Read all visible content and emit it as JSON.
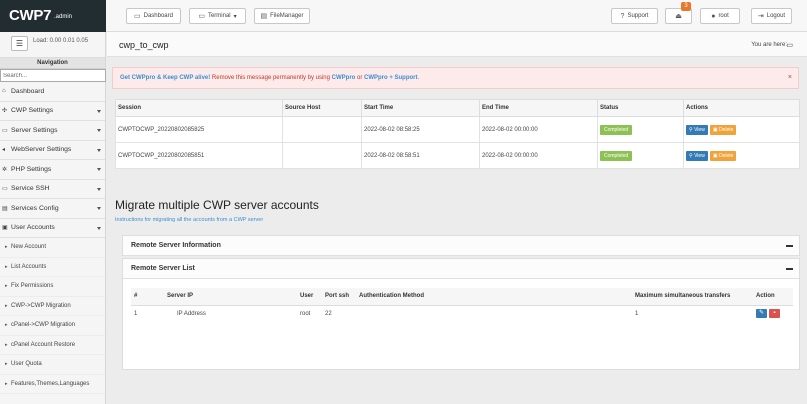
{
  "brand": {
    "name": "CWP7",
    "suffix": ".admin"
  },
  "topnav": {
    "dashboard": "Dashboard",
    "terminal": "Terminal",
    "filemanager": "FileManager",
    "support": "Support",
    "notifications_count": "3",
    "user": "root",
    "logout": "Logout"
  },
  "sidebar": {
    "load": "Load: 0.00 0.01 0.05",
    "nav_title": "Navigation",
    "search_placeholder": "Search...",
    "items": [
      {
        "label": "Dashboard",
        "icon": "home-icon"
      },
      {
        "label": "CWP Settings",
        "icon": "wrench-icon"
      },
      {
        "label": "Server Settings",
        "icon": "monitor-icon"
      },
      {
        "label": "WebServer Settings",
        "icon": "globe-icon"
      },
      {
        "label": "PHP Settings",
        "icon": "gear-icon"
      },
      {
        "label": "Service SSH",
        "icon": "monitor-icon"
      },
      {
        "label": "Services Config",
        "icon": "server-icon"
      },
      {
        "label": "User Accounts",
        "icon": "user-icon"
      }
    ],
    "subitems": [
      "New Account",
      "List Accounts",
      "Fix Permissions",
      "CWP->CWP Migration",
      "cPanel->CWP Migration",
      "cPanel Account Restore",
      "User Quota",
      "Features,Themes,Languages"
    ]
  },
  "page": {
    "title": "cwp_to_cwp",
    "you_are_here": "You are here:"
  },
  "alert": {
    "bold": "Get CWPpro & Keep CWP alive!",
    "text": " Remove this message permanently by using ",
    "link1": "CWPpro",
    "or": " or ",
    "link2": "CWPpro + Support",
    "end": ".",
    "close": "×"
  },
  "sessions": {
    "headers": [
      "Session",
      "Source Host",
      "Start Time",
      "End Time",
      "Status",
      "Actions"
    ],
    "rows": [
      {
        "session": "CWPTOCWP_20220802085825",
        "host": "",
        "start": "2022-08-02 08:58:25",
        "end": "2022-08-02 00:00:00",
        "status": "Completed",
        "view": "View",
        "delete": "Delete"
      },
      {
        "session": "CWPTOCWP_20220802085851",
        "host": "",
        "start": "2022-08-02 08:58:51",
        "end": "2022-08-02 00:00:00",
        "status": "Completed",
        "view": "View",
        "delete": "Delete"
      }
    ]
  },
  "migrate": {
    "title": "Migrate multiple CWP server accounts",
    "instructions": "Instructions for migrating all the accounts from a CWP server",
    "panel1": "Remote Server Information",
    "panel2": "Remote Server List",
    "headers": [
      "#",
      "Server IP",
      "User",
      "Port ssh",
      "Authentication Method",
      "Maximum simultaneous transfers",
      "Action"
    ],
    "rows": [
      {
        "num": "1",
        "ip": "IP Address",
        "user": "root",
        "port": "22",
        "auth": "",
        "max": "1"
      }
    ]
  },
  "colors": {
    "brand_bg": "#222d32",
    "status_completed": "#8dc153",
    "view_button": "#337ab7",
    "delete_button": "#f0a23b",
    "link": "#3a8fd0",
    "alert_bg": "#fdeaea"
  }
}
